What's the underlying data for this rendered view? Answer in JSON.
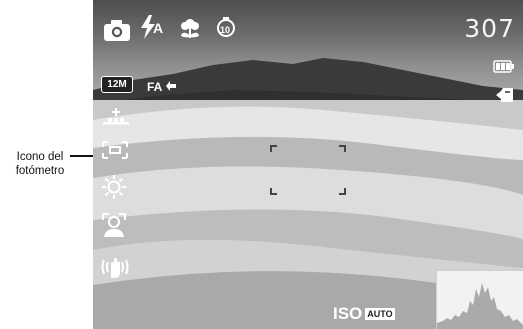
{
  "callout": {
    "line1": "Icono del",
    "line2": "fotómetro"
  },
  "camera_screen": {
    "shots_remaining": "307",
    "flash_mode_text": "A",
    "resolution": "12M",
    "focus_assist_text": "FA",
    "iso_label": "ISO",
    "iso_value": "AUTO"
  },
  "icons": {
    "top_row": [
      "camera-mode-icon",
      "flash-auto-icon",
      "macro-icon",
      "self-timer-10s-icon"
    ],
    "left_column": [
      "resolution-icon",
      "focus-assist-icon",
      "exposure-compensation-icon",
      "metering-icon",
      "white-balance-icon",
      "face-detection-icon",
      "anti-shake-icon"
    ],
    "right_column": [
      "battery-icon",
      "storage-card-icon"
    ],
    "bottom": [
      "histogram"
    ]
  },
  "colors": {
    "hud": "#ffffff",
    "sky_top": "#4e4e4e",
    "sand": "#d9d9d9"
  }
}
